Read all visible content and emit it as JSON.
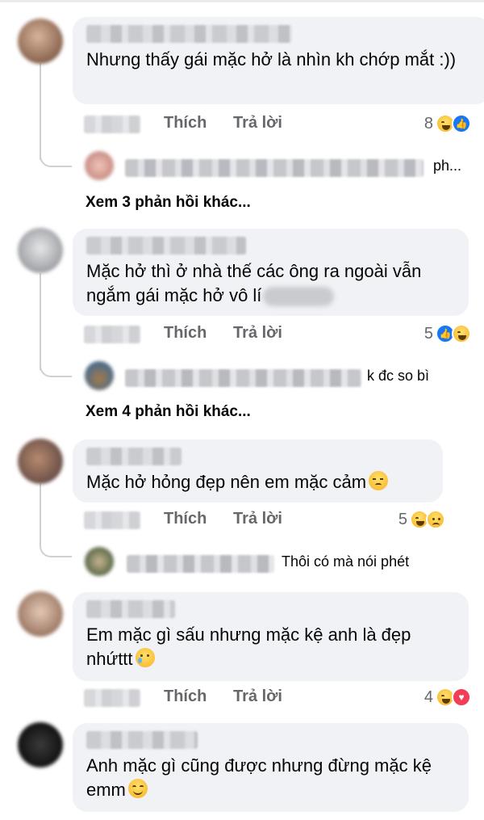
{
  "actions": {
    "like": "Thích",
    "reply": "Trả lời"
  },
  "colors": {
    "bubble_bg": "#f0f2f5",
    "meta_text": "#65676b",
    "like_blue": "#1877f2",
    "love_red": "#f33e58",
    "haha_yellow": "#f7b125"
  },
  "comments": [
    {
      "text": "Nhưng thấy gái mặc hở là nhìn kh chớp mắt :))",
      "reaction_count": "8",
      "reactions": [
        "haha-icon",
        "like-icon"
      ],
      "reply_preview_tail": "ph...",
      "more_replies": "Xem 3 phản hồi khác..."
    },
    {
      "text": "Mặc hở thì ở nhà thế các ông ra ngoài vẫn ngắm gái mặc hở vô lí",
      "reaction_count": "5",
      "reactions": [
        "like-icon",
        "haha-icon"
      ],
      "reply_preview_tail": "k đc so bì",
      "more_replies": "Xem 4 phản hồi khác..."
    },
    {
      "text": "Mặc hở hỏng đẹp nên em mặc cảm",
      "reaction_count": "5",
      "reactions": [
        "haha-icon",
        "sad-icon"
      ],
      "reply_preview_tail": "Thôi có mà nói phét"
    },
    {
      "text": "Em mặc gì sấu nhưng mặc kệ anh là đẹp nhứttt",
      "reaction_count": "4",
      "reactions": [
        "haha-icon",
        "love-icon"
      ]
    },
    {
      "text": "Anh mặc gì cũng được nhưng đừng mặc kệ emm"
    }
  ]
}
